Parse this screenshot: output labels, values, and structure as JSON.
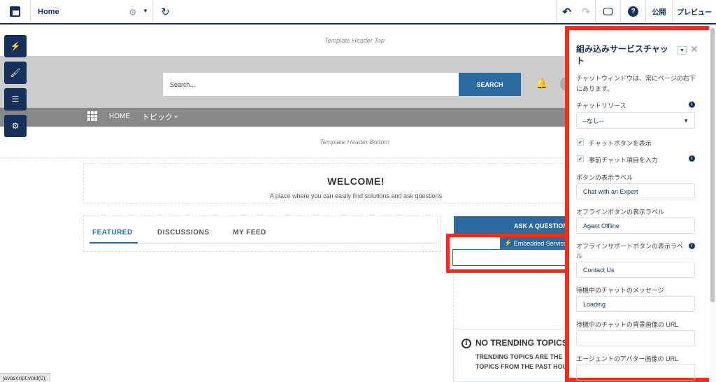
{
  "topbar": {
    "page_name": "Home",
    "publish_label": "公開",
    "preview_label": "プレビュー",
    "help_glyph": "?"
  },
  "canvas": {
    "header_top_label": "Template Header Top",
    "header_bottom_label": "Template Header Bottom",
    "search_placeholder": "Search...",
    "search_button": "SEARCH",
    "nav_home": "HOME",
    "nav_topics": "トピック",
    "welcome_title": "WELCOME!",
    "welcome_subtitle": "A place where you can easily find solutions and ask questions",
    "tabs": [
      {
        "label": "FEATURED"
      },
      {
        "label": "DISCUSSIONS"
      },
      {
        "label": "MY FEED"
      }
    ],
    "ask_button": "ASK A QUESTION",
    "embedded_tag": "Embedded Service Chat",
    "trending_title": "NO TRENDING TOPICS",
    "trending_line1": "TRENDING TOPICS ARE THE",
    "trending_line2": "TOPICS FROM THE PAST HOU"
  },
  "statusbar": {
    "text": "javascript:void(0);"
  },
  "panel": {
    "title": "組み込みサービスチャット",
    "description": "チャットウィンドウは、常にページの右下にあります。",
    "chat_release_label": "チャットリリース",
    "chat_release_value": "--なし--",
    "show_chat_button_label": "チャットボタンを表示",
    "prechat_label": "事前チャット項目を入力",
    "button_label_label": "ボタンの表示ラベル",
    "button_label_value": "Chat with an Expert",
    "offline_button_label": "オフラインボタンの表示ラベル",
    "offline_button_value": "Agent Offline",
    "offline_support_label": "オフラインサポートボタンの表示ラベル",
    "offline_support_value": "Contact Us",
    "waiting_message_label": "待機中のチャットのメッセージ",
    "waiting_message_value": "Loading",
    "waiting_bg_label": "待機中のチャットの背景画像の URL",
    "waiting_bg_value": "",
    "agent_avatar_label": "エージェントのアバター画像の URL",
    "agent_avatar_value": ""
  },
  "colors": {
    "brand_navy": "#16325c",
    "accent_blue": "#2b6aa0",
    "highlight_red": "#ff2a1a"
  }
}
